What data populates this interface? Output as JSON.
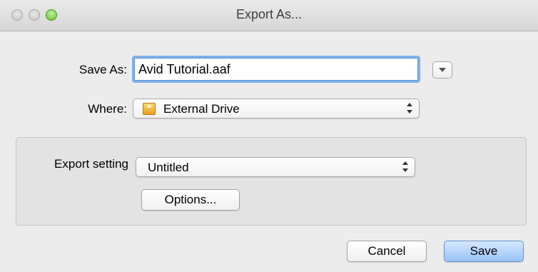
{
  "window": {
    "title": "Export As..."
  },
  "save_as": {
    "label": "Save As:",
    "value": "Avid Tutorial.aaf"
  },
  "where": {
    "label": "Where:",
    "value": "External Drive",
    "icon": "external-drive-icon"
  },
  "export_setting": {
    "label": "Export setting",
    "value": "Untitled"
  },
  "buttons": {
    "options": "Options...",
    "cancel": "Cancel",
    "save": "Save"
  },
  "colors": {
    "focus_ring": "#7fb0ea",
    "default_button": "#9bc3f6",
    "zoom_button": "#5cbf2c"
  }
}
